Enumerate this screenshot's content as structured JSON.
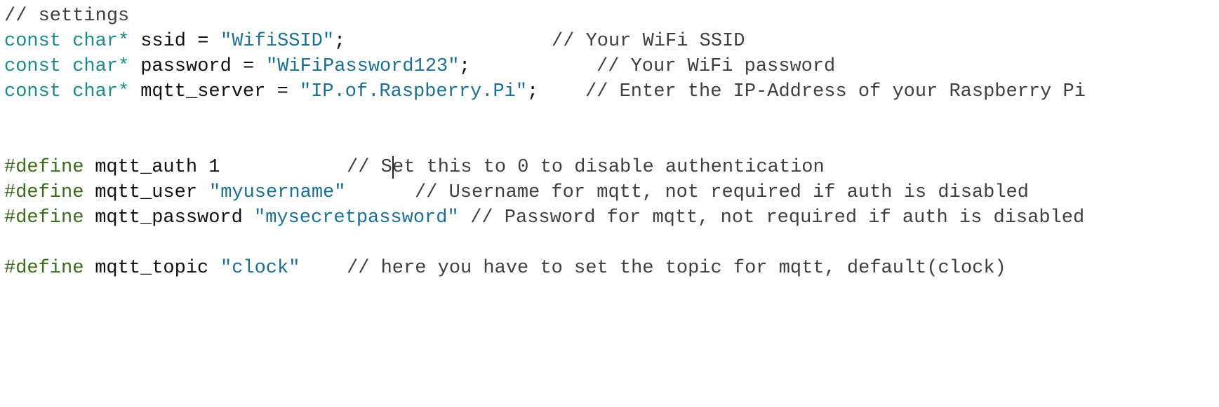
{
  "code": {
    "line1": {
      "comment": "// settings"
    },
    "line2": {
      "type": "const char*",
      "name": " ssid = ",
      "string": "\"WifiSSID\"",
      "end": ";",
      "comment": "// Your WiFi SSID"
    },
    "line3": {
      "type": "const char*",
      "name": " password = ",
      "string": "\"WiFiPassword123\"",
      "end": ";",
      "comment": "// Your WiFi password"
    },
    "line4": {
      "type": "const char*",
      "name": " mqtt_server = ",
      "string": "\"IP.of.Raspberry.Pi\"",
      "end": ";",
      "comment": "// Enter the IP-Address of your Raspberry Pi"
    },
    "line5": {
      "directive": "#define",
      "name": " mqtt_auth 1",
      "comment_before_caret": "// S",
      "comment_after_caret": "et this to 0 to disable authentication"
    },
    "line6": {
      "directive": "#define",
      "name": " mqtt_user ",
      "string": "\"myusername\"",
      "comment": "// Username for mqtt, not required if auth is disabled"
    },
    "line7": {
      "directive": "#define",
      "name": " mqtt_password ",
      "string": "\"mysecretpassword\"",
      "comment": " // Password for mqtt, not required if auth is disabled"
    },
    "line8": {
      "directive": "#define",
      "name": " mqtt_topic ",
      "string": "\"clock\"",
      "comment": "// here you have to set the topic for mqtt, default(clock)"
    }
  },
  "colors": {
    "background": "#ffffff",
    "comment": "#3f3f3f",
    "type": "#1f8a8a",
    "string": "#1d6f8f",
    "preprocessor": "#3b6a1e",
    "plain": "#111111"
  }
}
